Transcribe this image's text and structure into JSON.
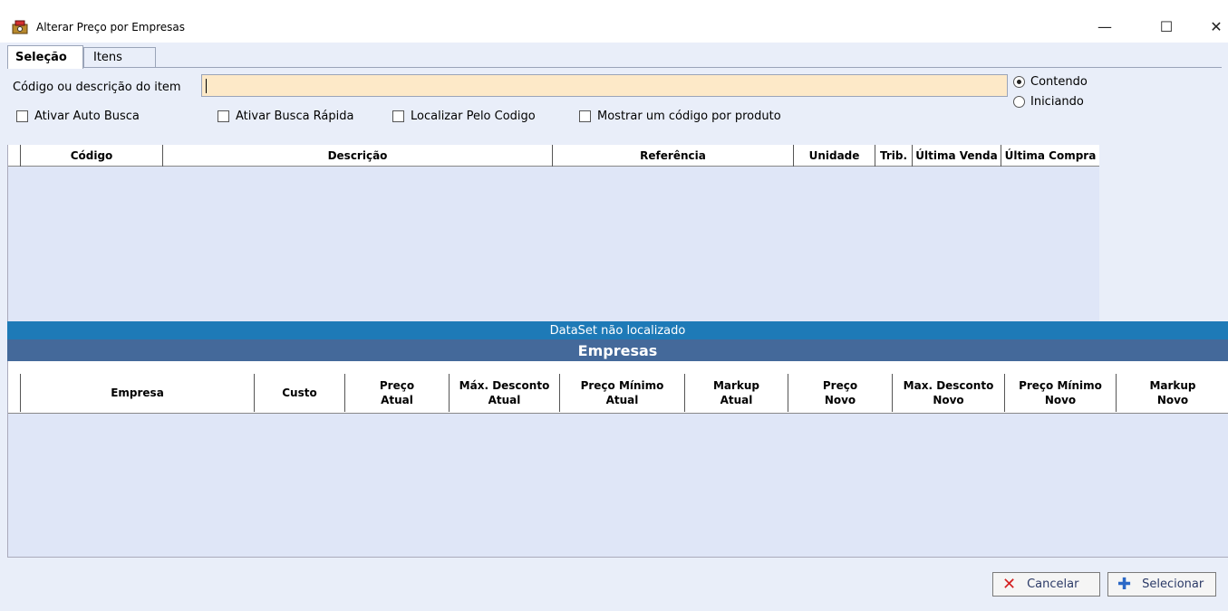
{
  "window": {
    "title": "Alterar Preço por Empresas",
    "min_glyph": "—",
    "max_glyph": "☐",
    "close_glyph": "✕",
    "icon": "app-icon"
  },
  "tabs": [
    {
      "label": "Seleção",
      "active": true
    },
    {
      "label": "Itens",
      "active": false
    }
  ],
  "search": {
    "label": "Código ou descrição do item",
    "value": "",
    "placeholder": ""
  },
  "search_mode": {
    "options": [
      {
        "label": "Contendo",
        "selected": true
      },
      {
        "label": "Iniciando",
        "selected": false
      }
    ]
  },
  "options": {
    "auto_busca": "Ativar Auto Busca",
    "busca_rapida": "Ativar Busca Rápida",
    "localizar_codigo": "Localizar Pelo Codigo",
    "um_codigo": "Mostrar um código por produto"
  },
  "items_grid": {
    "columns": [
      "Código",
      "Descrição",
      "Referência",
      "Unidade",
      "Trib.",
      "Última  Venda",
      "Última Compra"
    ]
  },
  "status": "DataSet não localizado",
  "empresas": {
    "title": "Empresas",
    "columns": [
      {
        "l1": "Empresa",
        "l2": ""
      },
      {
        "l1": "Custo",
        "l2": ""
      },
      {
        "l1": "Preço",
        "l2": "Atual"
      },
      {
        "l1": "Máx. Desconto",
        "l2": "Atual"
      },
      {
        "l1": "Preço Mínimo",
        "l2": "Atual"
      },
      {
        "l1": "Markup",
        "l2": "Atual"
      },
      {
        "l1": "Preço",
        "l2": "Novo"
      },
      {
        "l1": "Max. Desconto",
        "l2": "Novo"
      },
      {
        "l1": "Preço Mínimo",
        "l2": "Novo"
      },
      {
        "l1": "Markup",
        "l2": "Novo"
      }
    ]
  },
  "buttons": {
    "cancel": "Cancelar",
    "select": "Selecionar",
    "cancel_icon": "x-icon",
    "select_icon": "plus-icon"
  },
  "colors": {
    "status_bar": "#1e7ab7",
    "section_title": "#44699a",
    "input_bg": "#fde9c8"
  }
}
